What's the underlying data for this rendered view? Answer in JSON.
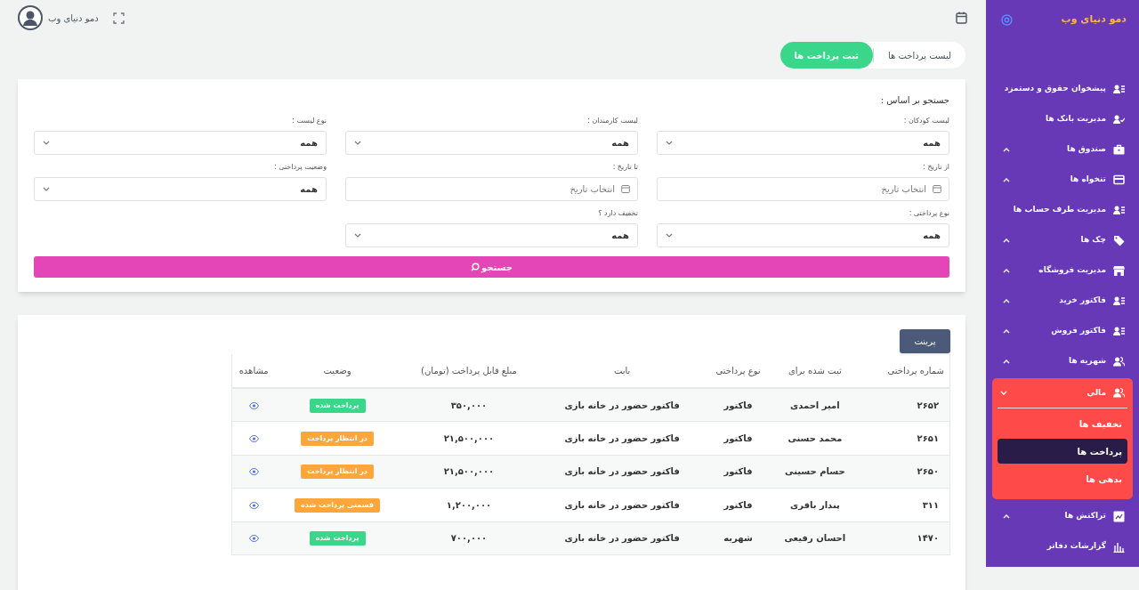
{
  "brand": {
    "title": "دمو دنیای وب"
  },
  "header": {
    "user_name": "دمو دنیای وب"
  },
  "tabs": [
    {
      "label": "لیست پرداخت ها",
      "selected": false
    },
    {
      "label": "ثبت پرداخت ها",
      "selected": true
    }
  ],
  "sidebar": {
    "items": [
      {
        "label": "پیشخوان حقوق و دستمزد"
      },
      {
        "label": "مدیریت بانک ها"
      },
      {
        "label": "صندوق ها",
        "expanded": false
      },
      {
        "label": "تنخواه ها",
        "expanded": false
      },
      {
        "label": "مدیریت طرف حساب ها"
      },
      {
        "label": "چک ها",
        "expanded": false
      },
      {
        "label": "مدیریت فروشگاه",
        "expanded": false
      },
      {
        "label": "فاکتور خرید",
        "expanded": false
      },
      {
        "label": "فاکتور فروش",
        "expanded": false
      },
      {
        "label": "شهریه ها",
        "expanded": false
      },
      {
        "label": "مالی",
        "expanded": true,
        "children": [
          {
            "label": "تخفیف ها",
            "selected": false
          },
          {
            "label": "پرداخت ها",
            "selected": true
          },
          {
            "label": "بدهی ها",
            "selected": false
          }
        ]
      },
      {
        "label": "تراکنش ها",
        "expanded": false
      },
      {
        "label": "گزارشات دفاتر"
      }
    ]
  },
  "search": {
    "title": "جستجو بر اساس :",
    "fields": [
      {
        "label": "لیست کودکان :",
        "kind": "select",
        "value": "همه"
      },
      {
        "label": "لیست کارمندان :",
        "kind": "select",
        "value": "همه"
      },
      {
        "label": "نوع لیست :",
        "kind": "select",
        "value": "همه"
      },
      {
        "label": "از تاریخ :",
        "kind": "date",
        "placeholder": "انتخاب تاریخ"
      },
      {
        "label": "تا تاریخ :",
        "kind": "date",
        "placeholder": "انتخاب تاریخ"
      },
      {
        "label": "وضعیت پرداختی :",
        "kind": "select",
        "value": "همه"
      },
      {
        "label": "نوع پرداختی :",
        "kind": "select",
        "value": "همه"
      },
      {
        "label": "تخفیف دارد ؟",
        "kind": "select",
        "value": "همه"
      }
    ],
    "button": "جستجو"
  },
  "print_button": "پرینت",
  "table": {
    "columns": [
      "شماره پرداختی",
      "ثبت شده برای",
      "نوع پرداختی",
      "بابت",
      "مبلغ قابل پرداخت (تومان)",
      "وضعیت",
      "مشاهده"
    ],
    "rows": [
      {
        "number": "۲۶۵۲",
        "person": "امیر احمدی",
        "type": "فاکتور",
        "reason": "فاکتور حضور در خانه بازی",
        "amount": "۳۵۰,۰۰۰",
        "status": "پرداخت شده",
        "color": "#3ad68a"
      },
      {
        "number": "۲۶۵۱",
        "person": "محمد حسنی",
        "type": "فاکتور",
        "reason": "فاکتور حضور در خانه بازی",
        "amount": "۲۱,۵۰۰,۰۰۰",
        "status": "در انتظار پرداخت",
        "color": "#fca63c"
      },
      {
        "number": "۲۶۵۰",
        "person": "حسام حسینی",
        "type": "فاکتور",
        "reason": "فاکتور حضور در خانه بازی",
        "amount": "۲۱,۵۰۰,۰۰۰",
        "status": "در انتظار پرداخت",
        "color": "#fca63c"
      },
      {
        "number": "۳۱۱",
        "person": "پندار باقری",
        "type": "فاکتور",
        "reason": "فاکتور حضور در خانه بازی",
        "amount": "۱,۲۰۰,۰۰۰",
        "status": "قسمتی پرداخت شده",
        "color": "#fca63c"
      },
      {
        "number": "۱۴۷۰",
        "person": "احسان رفیعی",
        "type": "شهریه",
        "reason": "فاکتور حضور در خانه بازی",
        "amount": "۷۰۰,۰۰۰",
        "status": "پرداخت شده",
        "color": "#3ad68a"
      }
    ]
  }
}
